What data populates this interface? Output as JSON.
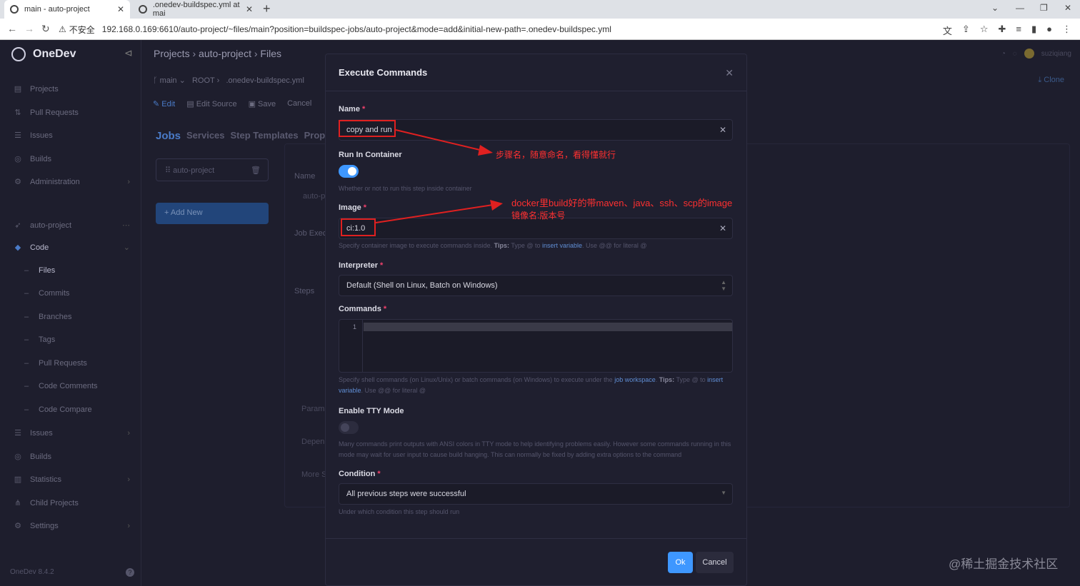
{
  "browser": {
    "tabs": [
      {
        "label": "main - auto-project"
      },
      {
        "label": ".onedev-buildspec.yml at mai"
      }
    ],
    "insecure_label": "不安全",
    "url": "192.168.0.169:6610/auto-project/~files/main?position=buildspec-jobs/auto-project&mode=add&initial-new-path=.onedev-buildspec.yml"
  },
  "sidebar": {
    "brand": "OneDev",
    "items": [
      {
        "label": "Projects",
        "icon": "projects-icon"
      },
      {
        "label": "Pull Requests",
        "icon": "pull-request-icon"
      },
      {
        "label": "Issues",
        "icon": "issues-icon"
      },
      {
        "label": "Builds",
        "icon": "builds-icon"
      },
      {
        "label": "Administration",
        "icon": "admin-icon"
      }
    ],
    "project": "auto-project",
    "code_label": "Code",
    "code_items": [
      "Files",
      "Commits",
      "Branches",
      "Tags",
      "Pull Requests",
      "Code Comments",
      "Code Compare"
    ],
    "project_items": [
      {
        "label": "Issues",
        "icon": "issues-icon"
      },
      {
        "label": "Builds",
        "icon": "builds-icon"
      },
      {
        "label": "Statistics",
        "icon": "statistics-icon"
      },
      {
        "label": "Child Projects",
        "icon": "child-projects-icon"
      },
      {
        "label": "Settings",
        "icon": "settings-icon"
      }
    ],
    "version": "OneDev 8.4.2"
  },
  "main": {
    "breadcrumb": [
      "Projects",
      "auto-project",
      "Files"
    ],
    "branch": "main",
    "path": [
      "ROOT",
      ".onedev-buildspec.yml"
    ],
    "edit_tabs": [
      "Edit",
      "Edit Source",
      "Save",
      "Cancel"
    ],
    "job_tabs": [
      "Jobs",
      "Services",
      "Step Templates",
      "Proper"
    ],
    "job_name": "auto-project",
    "add_new": "+ Add New",
    "user": "suziqiang",
    "clone": "Clone",
    "bg_labels": {
      "name": "Name",
      "name_value": "auto-p",
      "job_exec": "Job Execu",
      "steps": "Steps",
      "params": "Params",
      "depend": "Depen",
      "more": "More S"
    }
  },
  "modal": {
    "title": "Execute Commands",
    "name_label": "Name",
    "name_value": "copy and run",
    "run_in_container_label": "Run In Container",
    "run_in_container_hint": "Whether or not to run this step inside container",
    "run_in_container": true,
    "image_label": "Image",
    "image_value": "ci:1.0",
    "image_hint": {
      "pre": "Specify container image to execute commands inside.",
      "tips": "Tips:",
      "mid": "Type @ to",
      "link": "insert variable",
      "post": ". Use @@ for literal @"
    },
    "interpreter_label": "Interpreter",
    "interpreter_value": "Default (Shell on Linux, Batch on Windows)",
    "commands_label": "Commands",
    "commands_line_number": "1",
    "commands_hint": {
      "pre": "Specify shell commands (on Linux/Unix) or batch commands (on Windows) to execute under the",
      "link1": "job workspace",
      "tips": "Tips:",
      "mid": "Type @ to",
      "link2": "insert variable",
      "post": ". Use @@ for literal @"
    },
    "tty_label": "Enable TTY Mode",
    "tty_hint": "Many commands print outputs with ANSI colors in TTY mode to help identifying problems easily. However some commands running in this mode may wait for user input to cause build hanging. This can normally be fixed by adding extra options to the command",
    "tty_enabled": false,
    "condition_label": "Condition",
    "condition_value": "All previous steps were successful",
    "condition_hint": "Under which condition this step should run",
    "ok_label": "Ok",
    "cancel_label": "Cancel"
  },
  "annotations": {
    "name_note": "步骤名，随意命名，看得懂就行",
    "image_note_line1": "docker里build好的带maven、java、ssh、scp的image",
    "image_note_line2": "镜像名:版本号",
    "color": "#e02020"
  },
  "watermark": "@稀土掘金技术社区",
  "colors": {
    "accent": "#3e97ff",
    "required": "#f1416c",
    "modal_bg": "#1f1f2f"
  }
}
